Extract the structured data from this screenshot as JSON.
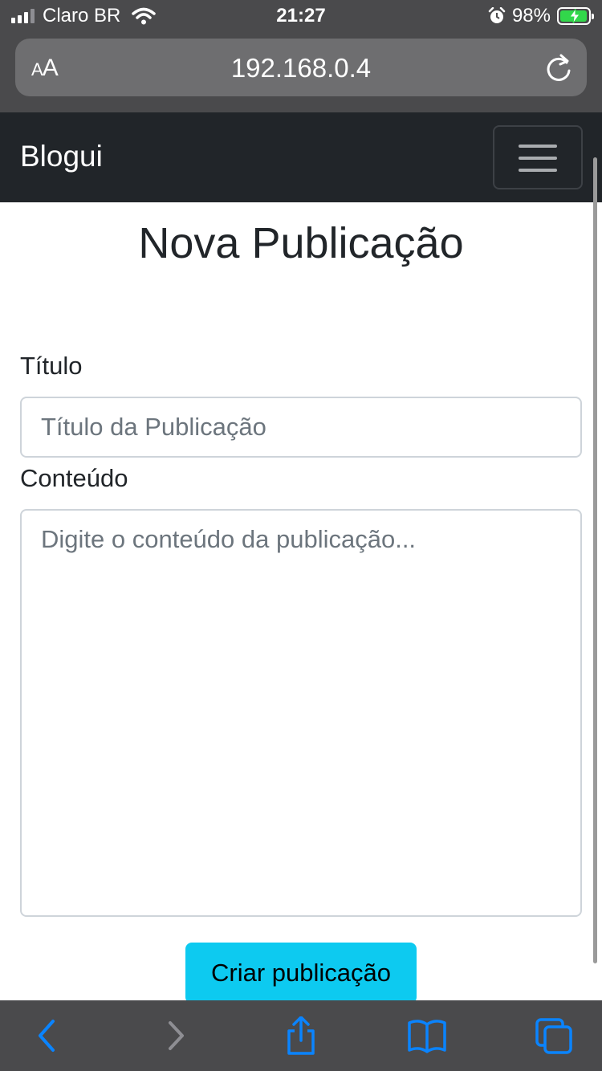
{
  "status_bar": {
    "carrier": "Claro BR",
    "time": "21:27",
    "battery": "98%",
    "battery_level": 0.98,
    "icons": [
      "signal-icon",
      "wifi-icon",
      "alarm-icon",
      "battery-icon"
    ]
  },
  "browser": {
    "text_size_label": "AA",
    "url": "192.168.0.4",
    "toolbar_icons": [
      "back-icon",
      "forward-icon",
      "share-icon",
      "bookmarks-icon",
      "tabs-icon"
    ],
    "accent_color": "#0a84ff"
  },
  "navbar": {
    "brand": "Blogui",
    "menu_icon": "hamburger-icon",
    "background": "#212529"
  },
  "form": {
    "title": "Nova Publicação",
    "title_label": "Título",
    "title_placeholder": "Título da Publicação",
    "title_value": "",
    "content_label": "Conteúdo",
    "content_placeholder": "Digite o conteúdo da publicação...",
    "content_value": "",
    "submit_label": "Criar publicação",
    "submit_color": "#0dcaf0"
  }
}
